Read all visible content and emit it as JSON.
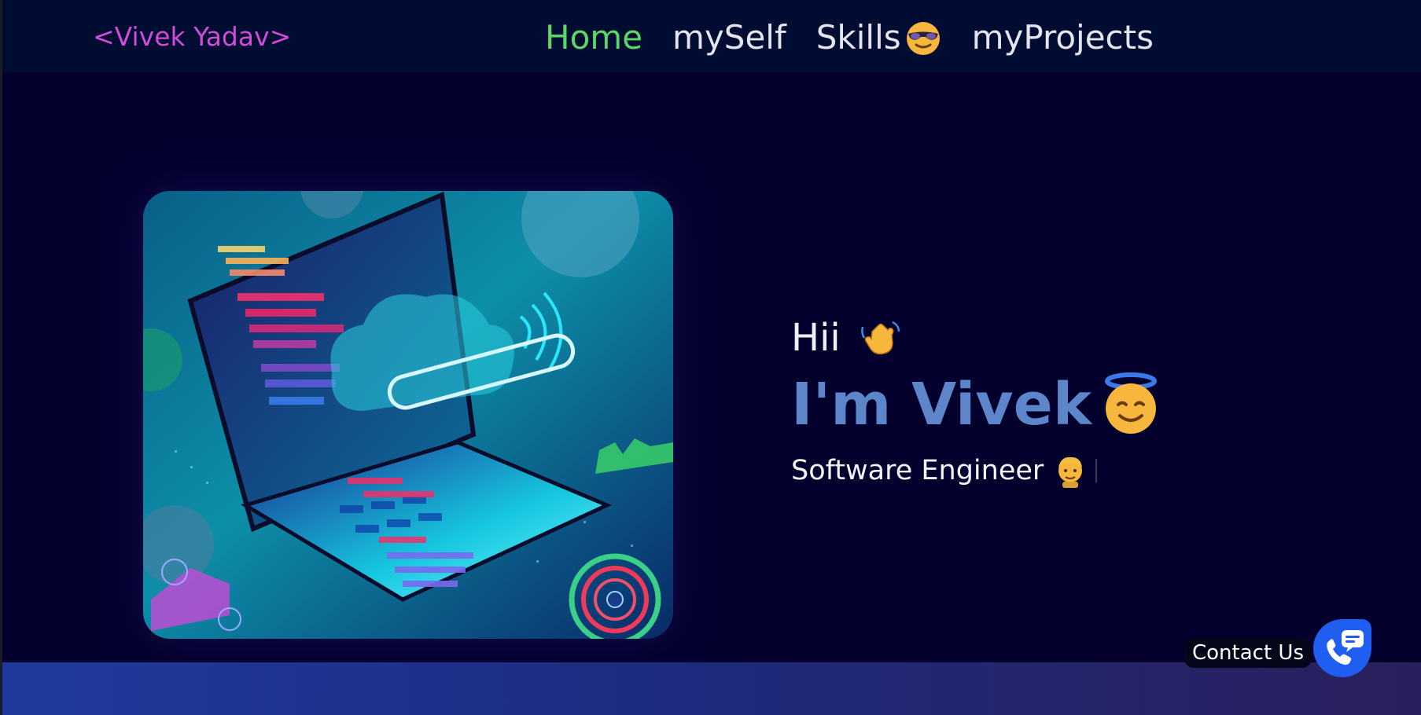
{
  "brand": {
    "text": "<Vivek Yadav>"
  },
  "nav": {
    "items": [
      {
        "label": "Home",
        "active": true
      },
      {
        "label": "mySelf",
        "active": false
      },
      {
        "label": "Skills",
        "icon": "sunglasses-face-icon",
        "active": false
      },
      {
        "label": "myProjects",
        "active": false
      }
    ]
  },
  "hero": {
    "image": "laptop-cloud-illustration",
    "greeting": "Hii",
    "greeting_icon": "waving-hand-icon",
    "headline": "I'm Vivek",
    "headline_icon": "smiling-face-with-halo-icon",
    "role": "Software Engineer",
    "role_icon": "person-emoji-icon"
  },
  "contact": {
    "label": "Contact Us",
    "icon": "phone-chat-icon"
  },
  "colors": {
    "background": "#03002e",
    "navbar": "#010c32",
    "brand": "#d24bd6",
    "nav_active": "#5ad866",
    "nav_text": "#e3e4ec",
    "headline": "#5c86c9",
    "contact_button": "#1f5ef0"
  }
}
